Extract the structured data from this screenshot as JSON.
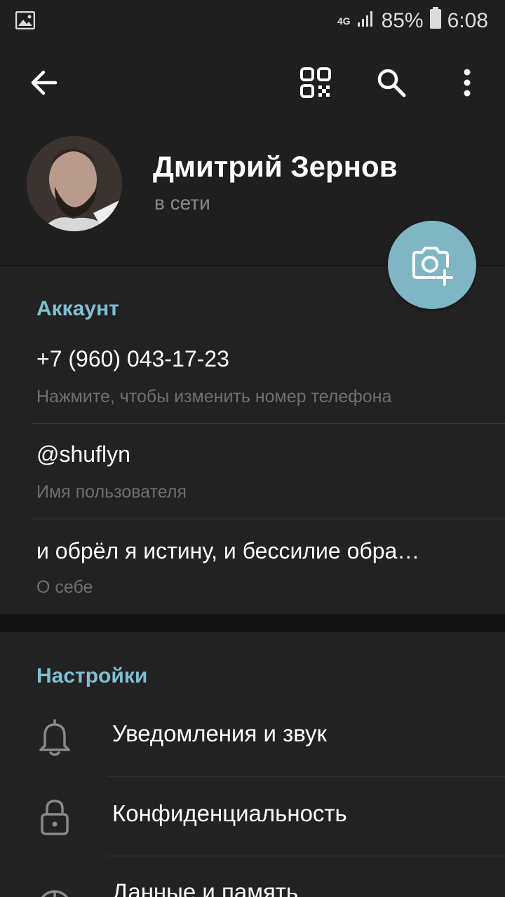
{
  "status_bar": {
    "network": "4G",
    "battery": "85%",
    "time": "6:08"
  },
  "profile": {
    "name": "Дмитрий Зернов",
    "status": "в сети"
  },
  "account": {
    "title": "Аккаунт",
    "phone": "+7 (960) 043-17-23",
    "phone_hint": "Нажмите, чтобы изменить номер телефона",
    "username": "@shuflyn",
    "username_label": "Имя пользователя",
    "bio": "и обрёл я истину, и бессилие обра…",
    "bio_label": "О себе"
  },
  "settings": {
    "title": "Настройки",
    "items": [
      {
        "label": "Уведомления и звук",
        "icon": "bell-icon"
      },
      {
        "label": "Конфиденциальность",
        "icon": "lock-icon"
      },
      {
        "label": "Данные и память",
        "icon": "pie-chart-icon"
      }
    ]
  },
  "colors": {
    "accent": "#7fbfd1",
    "fab": "#7fb6c4",
    "background": "#1f1f1f",
    "section": "#222222"
  }
}
